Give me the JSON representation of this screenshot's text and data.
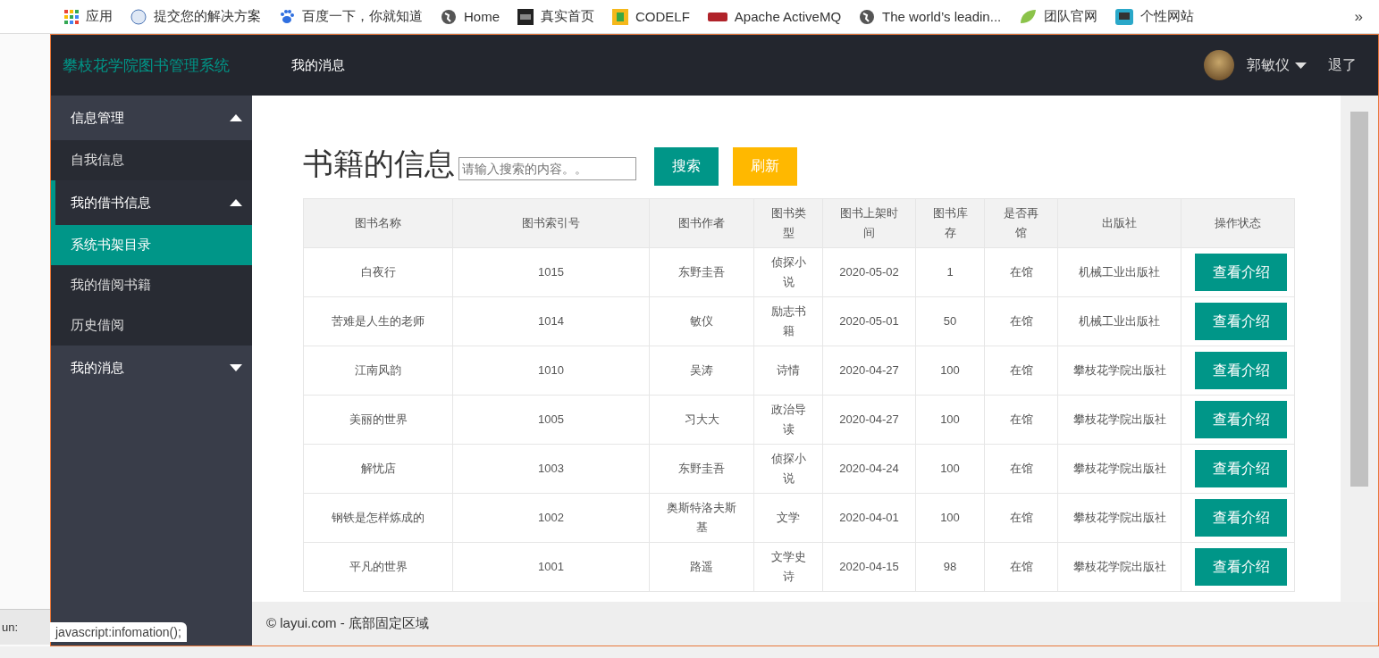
{
  "bookmarks": [
    {
      "label": "应用"
    },
    {
      "label": "提交您的解决方案"
    },
    {
      "label": "百度一下，你就知道"
    },
    {
      "label": "Home"
    },
    {
      "label": "真实首页"
    },
    {
      "label": "CODELF"
    },
    {
      "label": "Apache ActiveMQ"
    },
    {
      "label": "The world’s leadin..."
    },
    {
      "label": "团队官网"
    },
    {
      "label": "个性网站"
    }
  ],
  "bookmarks_more": "»",
  "background_window": {
    "label": "un:"
  },
  "header": {
    "title": "攀枝花学院图书管理系统",
    "nav": [
      "我的消息"
    ],
    "user": "郭敏仪",
    "logout": "退了"
  },
  "sidebar": {
    "items": [
      {
        "label": "信息管理",
        "expanded": true,
        "selected": false,
        "children": [
          {
            "label": "自我信息",
            "selected": false
          }
        ]
      },
      {
        "label": "我的借书信息",
        "expanded": true,
        "selected": true,
        "children": [
          {
            "label": "系统书架目录",
            "selected": true
          },
          {
            "label": "我的借阅书籍",
            "selected": false
          },
          {
            "label": "历史借阅",
            "selected": false
          }
        ]
      },
      {
        "label": "我的消息",
        "expanded": false,
        "selected": false
      }
    ]
  },
  "page": {
    "title": "书籍的信息",
    "search": {
      "placeholder": "请输入搜索的内容。。"
    },
    "buttons": [
      {
        "label": "搜索",
        "kind": "primary"
      },
      {
        "label": "刷新",
        "kind": "warm"
      }
    ]
  },
  "table": {
    "columns": [
      "图书名称",
      "图书索引号",
      "图书作者",
      "图书类型",
      "图书上架时间",
      "图书库存",
      "是否再馆",
      "出版社",
      "操作状态"
    ],
    "rows": [
      {
        "cells": [
          "白夜行",
          "1015",
          "东野圭吾",
          "侦探小说",
          "2020-05-02",
          "1",
          "在馆",
          "机械工业出版社"
        ],
        "action": "查看介绍"
      },
      {
        "cells": [
          "苦难是人生的老师",
          "1014",
          "敏仪",
          "励志书籍",
          "2020-05-01",
          "50",
          "在馆",
          "机械工业出版社"
        ],
        "action": "查看介绍"
      },
      {
        "cells": [
          "江南风韵",
          "1010",
          "吴涛",
          "诗情",
          "2020-04-27",
          "100",
          "在馆",
          "攀枝花学院出版社"
        ],
        "action": "查看介绍"
      },
      {
        "cells": [
          "美丽的世界",
          "1005",
          "习大大",
          "政治导读",
          "2020-04-27",
          "100",
          "在馆",
          "攀枝花学院出版社"
        ],
        "action": "查看介绍"
      },
      {
        "cells": [
          "解忧店",
          "1003",
          "东野圭吾",
          "侦探小说",
          "2020-04-24",
          "100",
          "在馆",
          "攀枝花学院出版社"
        ],
        "action": "查看介绍"
      },
      {
        "cells": [
          "钢铁是怎样炼成的",
          "1002",
          "奥斯特洛夫斯基",
          "文学",
          "2020-04-01",
          "100",
          "在馆",
          "攀枝花学院出版社"
        ],
        "action": "查看介绍"
      },
      {
        "cells": [
          "平凡的世界",
          "1001",
          "路遥",
          "文学史诗",
          "2020-04-15",
          "98",
          "在馆",
          "攀枝花学院出版社"
        ],
        "action": "查看介绍"
      }
    ]
  },
  "footer": "© layui.com - 底部固定区域",
  "status_tooltip": "javascript:infomation();"
}
